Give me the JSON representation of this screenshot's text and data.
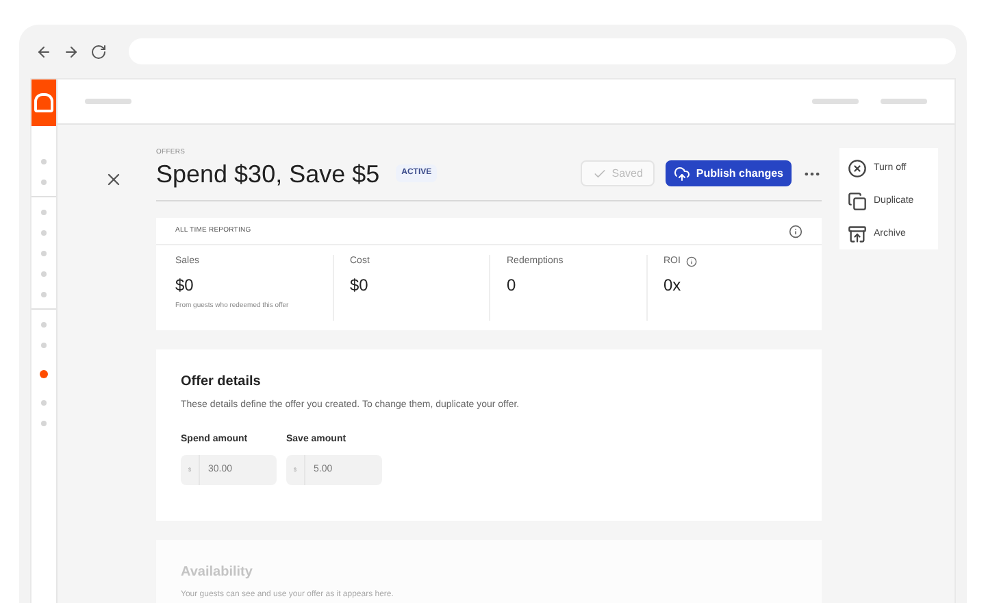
{
  "sidebar": {
    "groups": [
      [
        {
          "selected": false
        },
        {
          "selected": false
        }
      ],
      [
        {
          "selected": false
        },
        {
          "selected": false
        },
        {
          "selected": false
        },
        {
          "selected": false
        },
        {
          "selected": false
        }
      ],
      [
        {
          "selected": false
        },
        {
          "selected": false
        },
        {
          "selected": true
        },
        {
          "selected": false
        },
        {
          "selected": false
        }
      ]
    ]
  },
  "header": {
    "breadcrumb": "OFFERS",
    "title": "Spend $30, Save $5",
    "status": "ACTIVE"
  },
  "actions": {
    "saved": {
      "label": "Saved",
      "disabled": true
    },
    "publish": {
      "label": "Publish changes"
    }
  },
  "menu": [
    {
      "kind": "off",
      "label": "Turn off"
    },
    {
      "kind": "duplicate",
      "label": "Duplicate"
    },
    {
      "kind": "archive",
      "label": "Archive"
    }
  ],
  "reporting": {
    "title": "ALL TIME REPORTING",
    "metrics": [
      {
        "label": "Sales",
        "value": "$0",
        "note": "From guests who redeemed this offer",
        "info": false
      },
      {
        "label": "Cost",
        "value": "$0",
        "info": false
      },
      {
        "label": "Redemptions",
        "value": "0",
        "info": false
      },
      {
        "label": "ROI",
        "value": "0x",
        "info": true
      }
    ]
  },
  "offer_details": {
    "title": "Offer details",
    "description": "These details define the offer you created. To change them, duplicate your offer.",
    "fields": [
      {
        "label": "Spend amount",
        "prefix": "$",
        "value": "30.00"
      },
      {
        "label": "Save amount",
        "prefix": "$",
        "value": "5.00"
      }
    ]
  },
  "availability": {
    "title": "Availability",
    "description": "Your guests can see and use your offer as it appears here."
  }
}
